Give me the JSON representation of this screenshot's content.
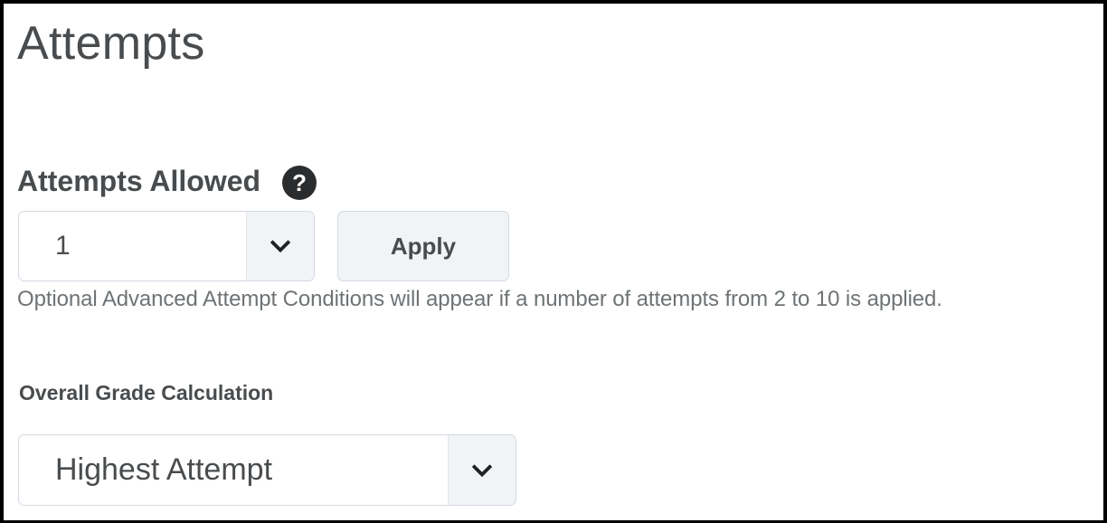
{
  "page": {
    "title": "Attempts"
  },
  "attempts_allowed": {
    "heading": "Attempts Allowed",
    "help_icon": "help-circle-icon",
    "help_glyph": "?",
    "selected_value": "1",
    "apply_label": "Apply",
    "help_text": "Optional Advanced Attempt Conditions will appear if a number of attempts from 2 to 10 is applied."
  },
  "overall_grade": {
    "label": "Overall Grade Calculation",
    "selected_value": "Highest Attempt",
    "dropdown_icon": "chevron-down-icon"
  },
  "colors": {
    "text": "#494c4e",
    "muted_text": "#6e7376",
    "border": "#d3d9e3",
    "button_bg": "#f1f3f5",
    "icon_dark": "#2b2c2e"
  }
}
